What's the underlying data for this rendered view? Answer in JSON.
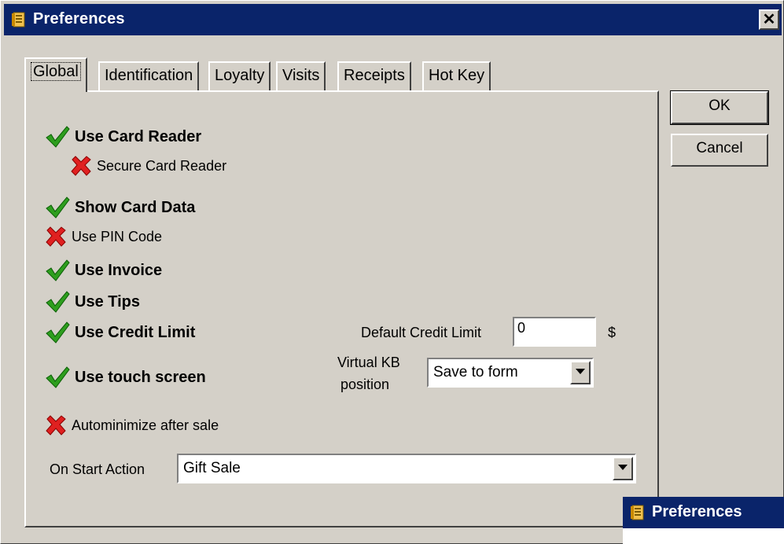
{
  "window": {
    "title": "Preferences",
    "close_label": "✕"
  },
  "tabs": [
    {
      "label": "Global",
      "active": true
    },
    {
      "label": "Identification",
      "active": false
    },
    {
      "label": "Loyalty",
      "active": false
    },
    {
      "label": "Visits",
      "active": false
    },
    {
      "label": "Receipts",
      "active": false
    },
    {
      "label": "Hot Key",
      "active": false
    }
  ],
  "options": {
    "use_card_reader": {
      "label": "Use Card Reader",
      "checked": true
    },
    "secure_card_reader": {
      "label": "Secure Card Reader",
      "checked": false
    },
    "show_card_data": {
      "label": "Show Card Data",
      "checked": true
    },
    "use_pin_code": {
      "label": "Use PIN Code",
      "checked": false
    },
    "use_invoice": {
      "label": "Use Invoice",
      "checked": true
    },
    "use_tips": {
      "label": "Use Tips",
      "checked": true
    },
    "use_credit_limit": {
      "label": "Use Credit Limit",
      "checked": true
    },
    "use_touch_screen": {
      "label": "Use touch screen",
      "checked": true
    },
    "autominimize": {
      "label": "Autominimize after sale",
      "checked": false
    }
  },
  "credit_limit": {
    "label": "Default Credit Limit",
    "value": "0",
    "unit": "$"
  },
  "virtual_kb": {
    "label_line1": "Virtual KB",
    "label_line2": "position",
    "value": "Save to form"
  },
  "on_start": {
    "label": "On Start Action",
    "value": "Gift Sale"
  },
  "buttons": {
    "ok": "OK",
    "cancel": "Cancel"
  },
  "taskbar": {
    "title": "Preferences"
  },
  "colors": {
    "titlebar": "#0a246a",
    "check": "#2e9e1e",
    "cross": "#e02020",
    "face": "#d4d0c8"
  }
}
